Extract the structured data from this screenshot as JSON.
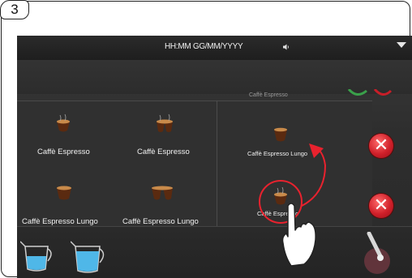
{
  "step": {
    "number": "3"
  },
  "status_bar": {
    "time_date": "HH:MM GG/MM/YYYY"
  },
  "partial_item": {
    "label": "Caffè Espresso"
  },
  "tiles": [
    {
      "label": "Caffè Espresso"
    },
    {
      "label": "Caffè Espresso"
    },
    {
      "label": "Caffè Espresso Lungo"
    },
    {
      "label": "Caffè Espresso Lungo"
    },
    {
      "label": "Caffè Espresso Lungo"
    },
    {
      "label": "Caffè Espresso"
    }
  ],
  "colors": {
    "accent_red": "#d0202a",
    "gesture_arrow": "#e8222e",
    "water_blue": "#4fb7e8"
  },
  "icons": [
    "volume-icon",
    "dropdown-arrow-icon",
    "delete-icon",
    "water-jug-icon",
    "steam-wand-icon",
    "hand-pointer-icon"
  ]
}
